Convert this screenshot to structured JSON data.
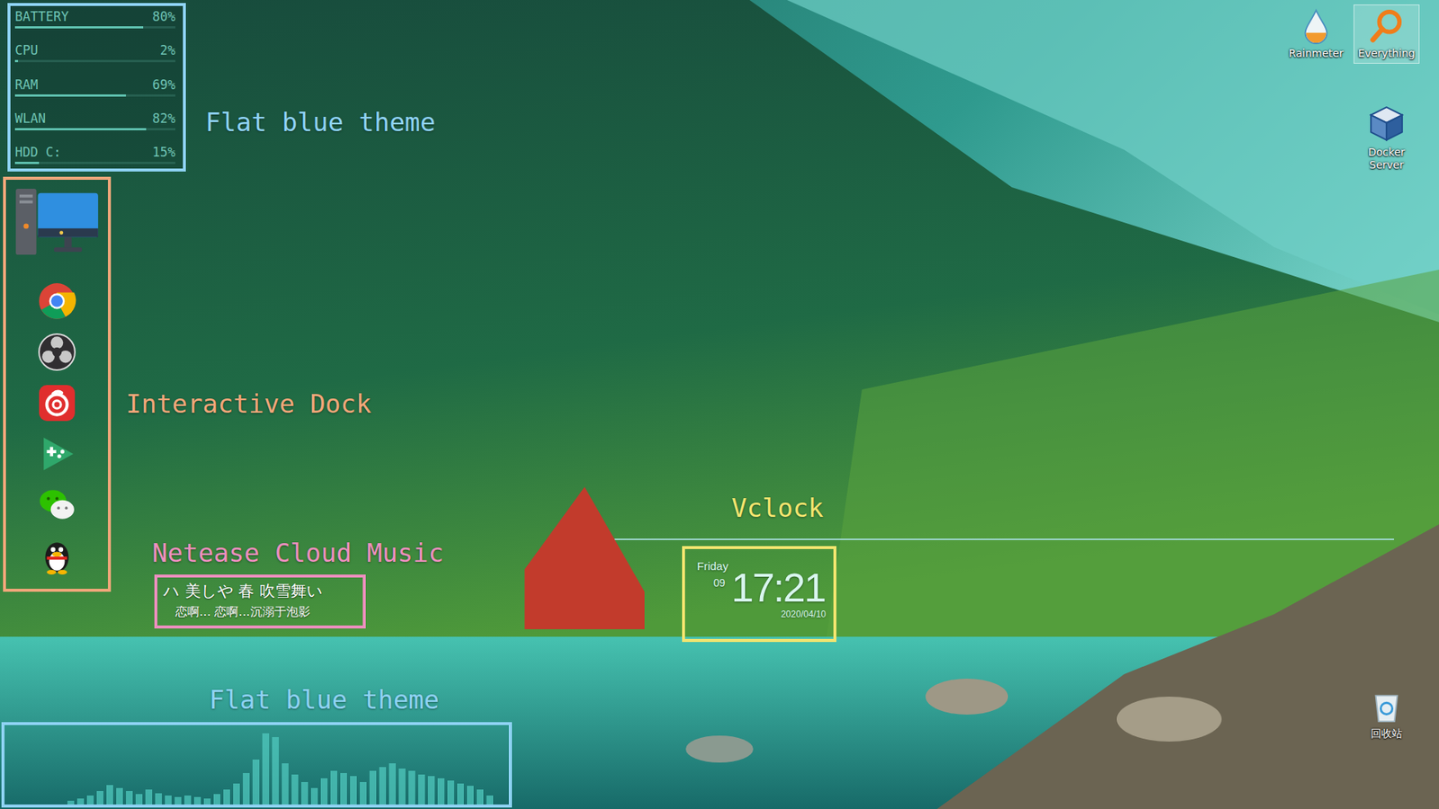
{
  "system_monitor": {
    "annotation": {
      "label": "Flat blue theme",
      "color": "#8fd3f4"
    },
    "rows": [
      {
        "label": "BATTERY",
        "reading": "80%",
        "level": 0.8
      },
      {
        "label": "CPU",
        "reading": "2%",
        "level": 0.02
      },
      {
        "label": "RAM",
        "reading": "69%",
        "level": 0.69
      },
      {
        "label": "WLAN",
        "reading": "82%",
        "level": 0.82
      },
      {
        "label": "HDD C:",
        "reading": "15%",
        "level": 0.15
      }
    ]
  },
  "dock": {
    "annotation": {
      "label": "Interactive Dock",
      "color": "#f2a77a"
    },
    "items": [
      {
        "kind": "computer"
      },
      {
        "kind": "chrome"
      },
      {
        "kind": "obs"
      },
      {
        "kind": "netease"
      },
      {
        "kind": "game"
      },
      {
        "kind": "wechat"
      },
      {
        "kind": "qq"
      }
    ]
  },
  "lyrics": {
    "annotation": {
      "label": "Netease Cloud Music",
      "color": "#ee8fbf"
    },
    "lines": [
      "ハ 美しや 春 吹雪舞い",
      "恋啊... 恋啊...沉溺于泡影"
    ]
  },
  "clock": {
    "annotation": {
      "label": "Vclock",
      "color": "#f4e56f"
    },
    "weekday": "Friday",
    "day": "09",
    "time": "17:21",
    "date": "2020/04/10"
  },
  "visualizer": {
    "annotation": {
      "label": "Flat blue theme",
      "color": "#8fd3f4"
    },
    "values": [
      0.05,
      0.08,
      0.12,
      0.18,
      0.26,
      0.22,
      0.18,
      0.14,
      0.2,
      0.15,
      0.12,
      0.1,
      0.12,
      0.1,
      0.08,
      0.14,
      0.2,
      0.28,
      0.42,
      0.6,
      0.95,
      0.9,
      0.55,
      0.4,
      0.3,
      0.22,
      0.35,
      0.45,
      0.42,
      0.38,
      0.3,
      0.45,
      0.5,
      0.55,
      0.48,
      0.45,
      0.4,
      0.38,
      0.35,
      0.32,
      0.28,
      0.25,
      0.2,
      0.12
    ]
  },
  "desktop_icons": [
    {
      "label": "Rainmeter",
      "kind": "rainmeter",
      "selected": false
    },
    {
      "label": "Everything",
      "kind": "everything",
      "selected": true
    },
    {
      "label": "Docker Server",
      "kind": "docker",
      "selected": false
    },
    {
      "label": "回收站",
      "kind": "recycle",
      "selected": false
    }
  ]
}
